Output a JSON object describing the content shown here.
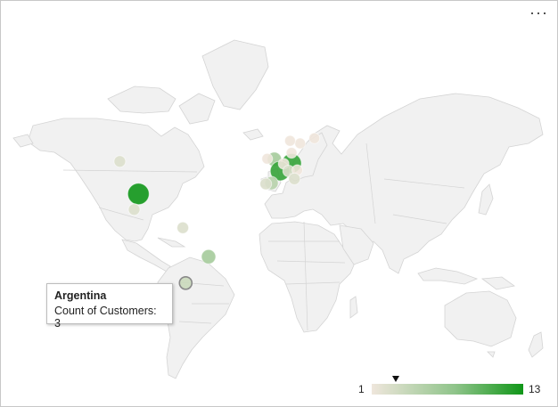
{
  "chart_data": {
    "type": "geo-bubble",
    "title": "",
    "metric": "Count of Customers",
    "scale": {
      "min": 1,
      "max": 13,
      "min_color": "#efe6dc",
      "max_color": "#109618"
    },
    "points": [
      {
        "lon": -97,
        "lat": 33,
        "value": 13
      },
      {
        "lon": -110,
        "lat": 52,
        "value": 2
      },
      {
        "lon": -100,
        "lat": 22,
        "value": 2
      },
      {
        "lon": -66,
        "lat": 8,
        "value": 2
      },
      {
        "lon": -48,
        "lat": -15,
        "value": 5
      },
      {
        "lon": -64,
        "lat": -34,
        "value": 3,
        "selected": true
      },
      {
        "lon": -2,
        "lat": 53,
        "value": 5
      },
      {
        "lon": -7,
        "lat": 53.3,
        "value": 1
      },
      {
        "lon": 10,
        "lat": 51,
        "value": 11
      },
      {
        "lon": 2,
        "lat": 47,
        "value": 11
      },
      {
        "lon": 4.5,
        "lat": 50.8,
        "value": 1
      },
      {
        "lon": 8,
        "lat": 47,
        "value": 2
      },
      {
        "lon": 14,
        "lat": 47.5,
        "value": 1
      },
      {
        "lon": -4,
        "lat": 40,
        "value": 4
      },
      {
        "lon": -8,
        "lat": 39.5,
        "value": 2
      },
      {
        "lon": 12,
        "lat": 42.5,
        "value": 2
      },
      {
        "lon": 10,
        "lat": 56,
        "value": 1
      },
      {
        "lon": 26,
        "lat": 62,
        "value": 1
      },
      {
        "lon": 16,
        "lat": 60,
        "value": 1
      },
      {
        "lon": 9,
        "lat": 61,
        "value": 1
      }
    ]
  },
  "tooltip": {
    "country": "Argentina",
    "metric_label": "Count of Customers:",
    "value": "3"
  },
  "legend": {
    "min": "1",
    "max": "13"
  },
  "menu": {
    "icon": "more-options-icon",
    "glyph": "···"
  }
}
